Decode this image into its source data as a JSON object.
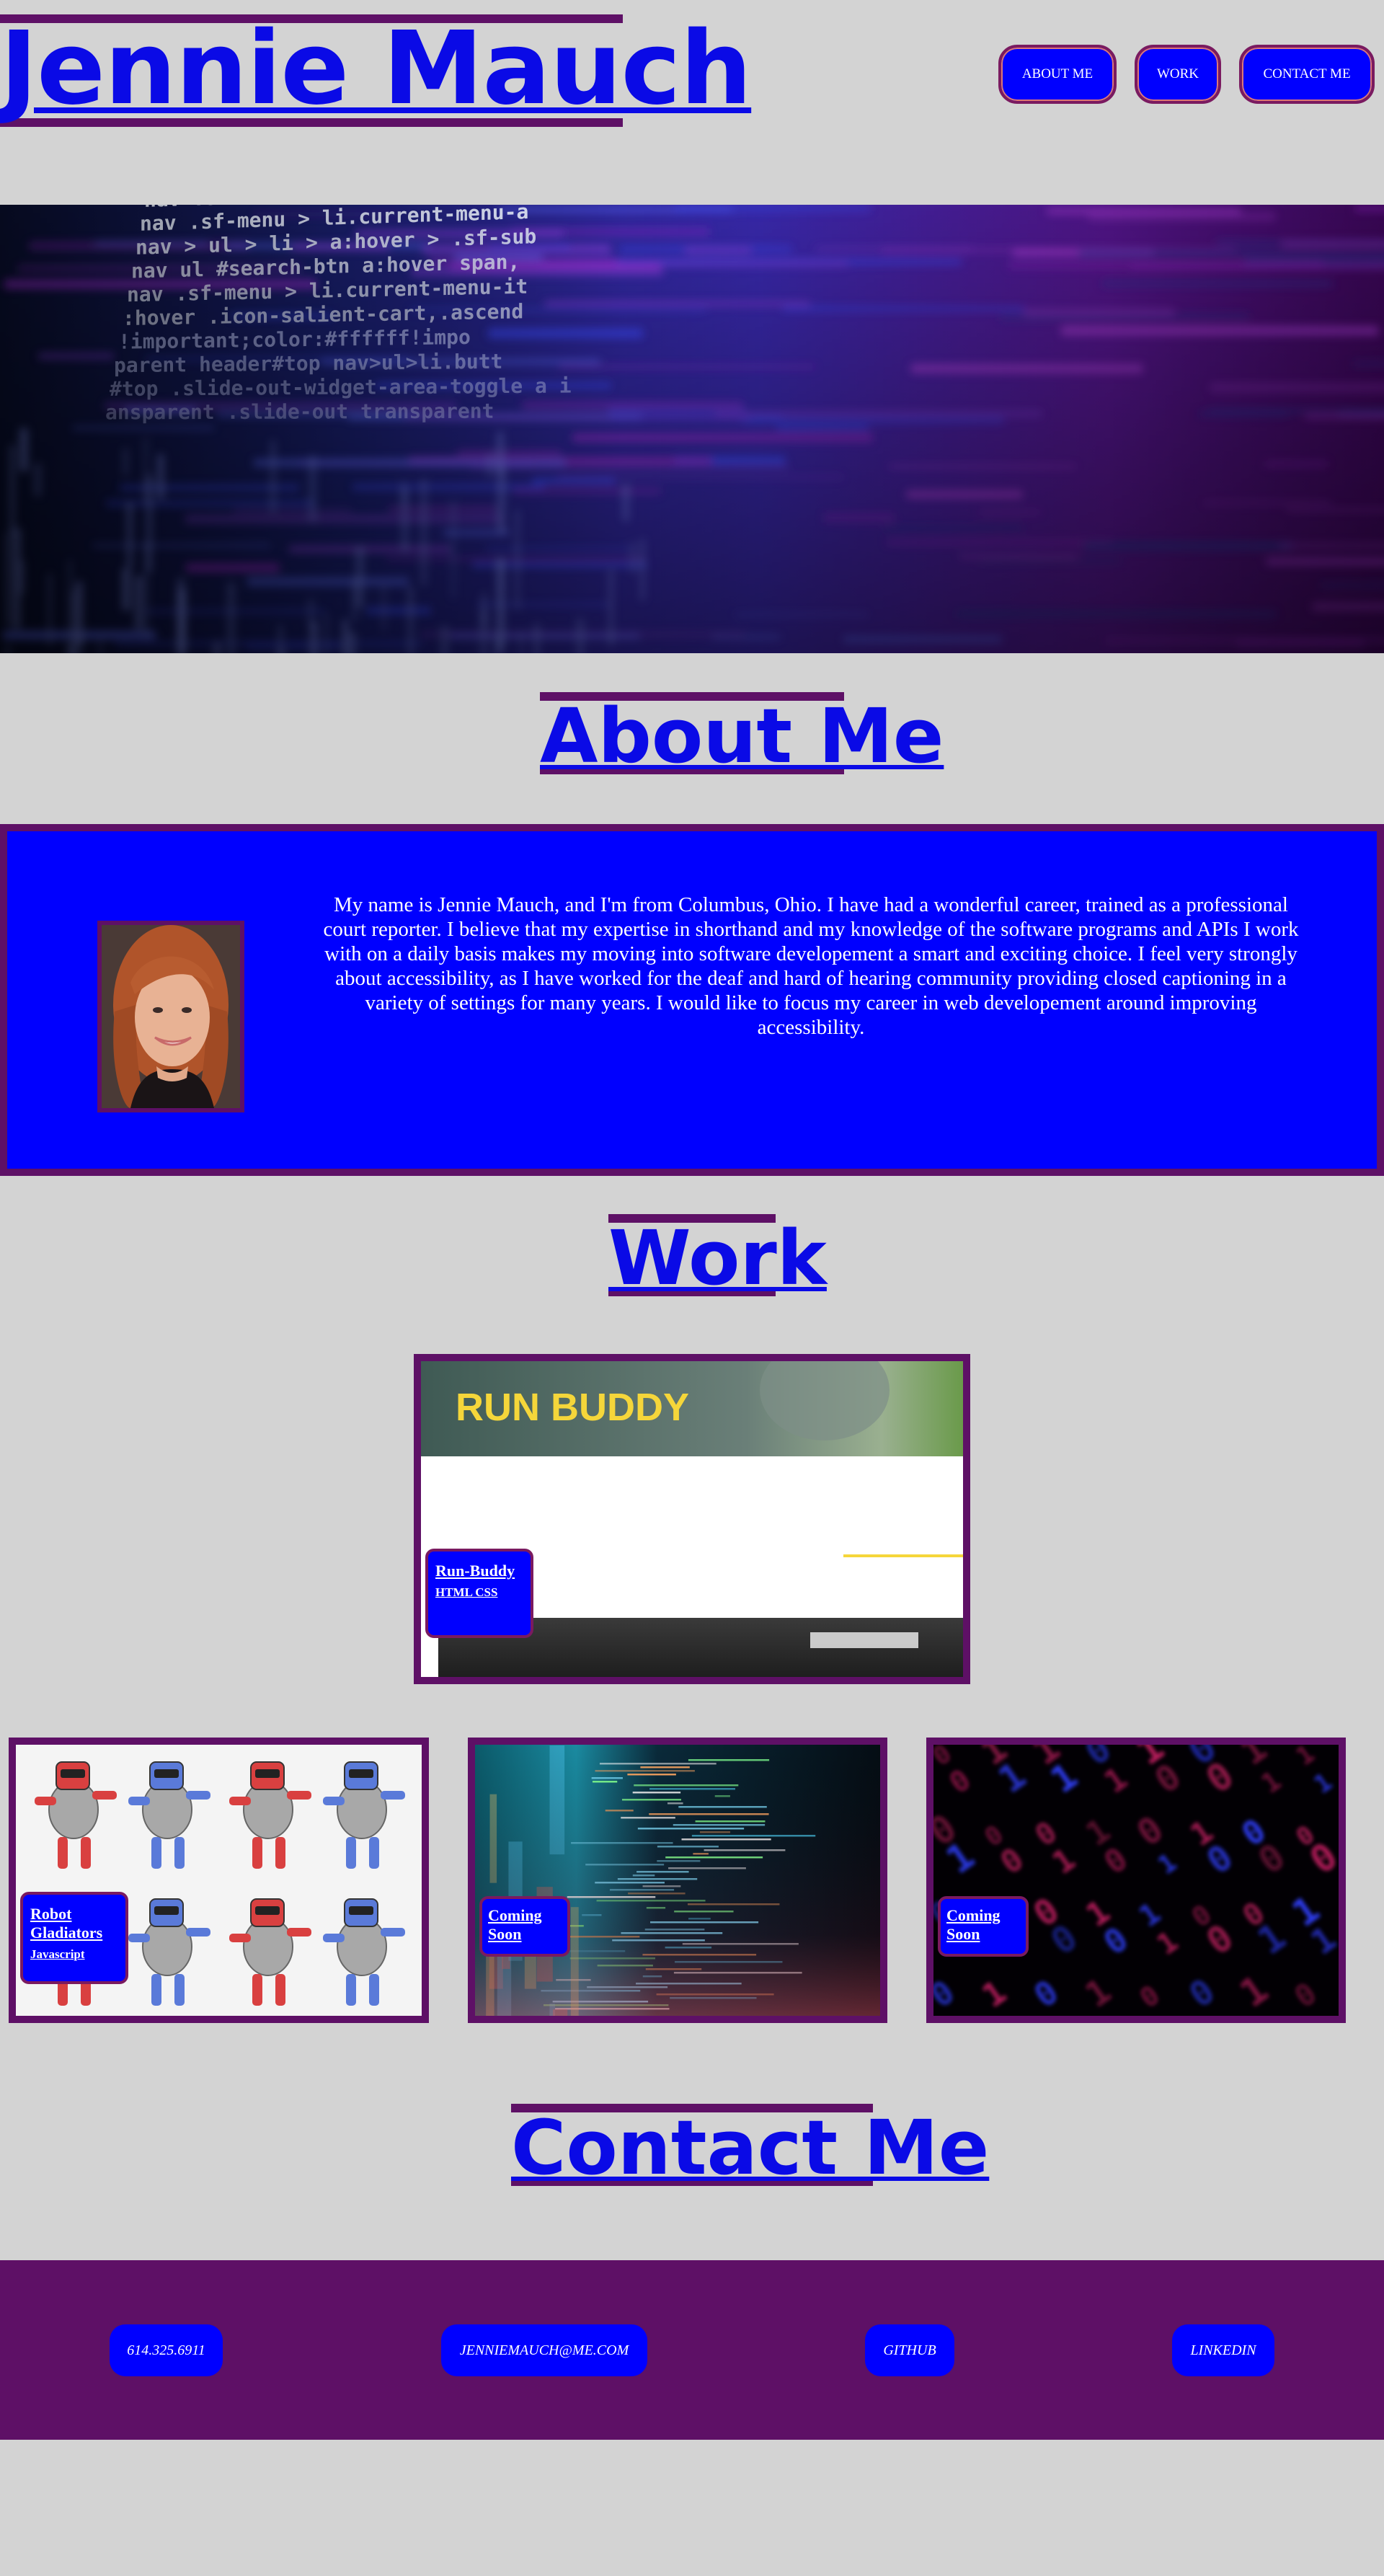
{
  "header": {
    "title": "Jennie Mauch",
    "nav": [
      {
        "label": "ABOUT ME"
      },
      {
        "label": "WORK"
      },
      {
        "label": "CONTACT ME"
      }
    ]
  },
  "hero": {
    "code_lines": [
      "nav .sf-menu > li.current_page_",
      "nav .sf-menu > li.current-menu-a",
      "nav > ul > li > a:hover > .sf-sub",
      "nav ul #search-btn a:hover span,",
      "nav .sf-menu > li.current-menu-it",
      ":hover .icon-salient-cart,.ascend",
      "!important;color:#ffffff!impo",
      "parent header#top nav>ul>li.butt",
      "#top .slide-out-widget-area-toggle a i",
      "ansparent .slide-out transparent"
    ]
  },
  "about": {
    "heading": "About Me",
    "text": "My name is Jennie Mauch, and I'm from Columbus, Ohio. I have had a wonderful career, trained as a professional court reporter. I believe that my expertise in shorthand and my knowledge of the software programs and APIs I work with on a daily basis makes my moving into software developement a smart and exciting choice. I feel very strongly about accessibility, as I have worked for the deaf and hard of hearing community providing closed captioning in a variety of settings for many years. I would like to focus my career in web developement around improving accessibility."
  },
  "work": {
    "heading": "Work",
    "featured": {
      "image_text": "RUN BUDDY",
      "title": "Run-Buddy",
      "subtitle": "HTML CSS"
    },
    "projects": [
      {
        "title": "Robot Gladiators",
        "subtitle": "Javascript"
      },
      {
        "title": "Coming Soon",
        "subtitle": ""
      },
      {
        "title": "Coming Soon",
        "subtitle": ""
      }
    ]
  },
  "contact": {
    "heading": "Contact Me",
    "items": [
      {
        "label": "614.325.6911"
      },
      {
        "label": "JENNIEMAUCH@ME.COM"
      },
      {
        "label": "GITHUB"
      },
      {
        "label": "LINKEDIN"
      }
    ]
  },
  "colors": {
    "background": "#d3d3d3",
    "accent_purple": "#5e1066",
    "primary_blue": "#0000ff",
    "heading_blue": "#0a0ae6"
  }
}
